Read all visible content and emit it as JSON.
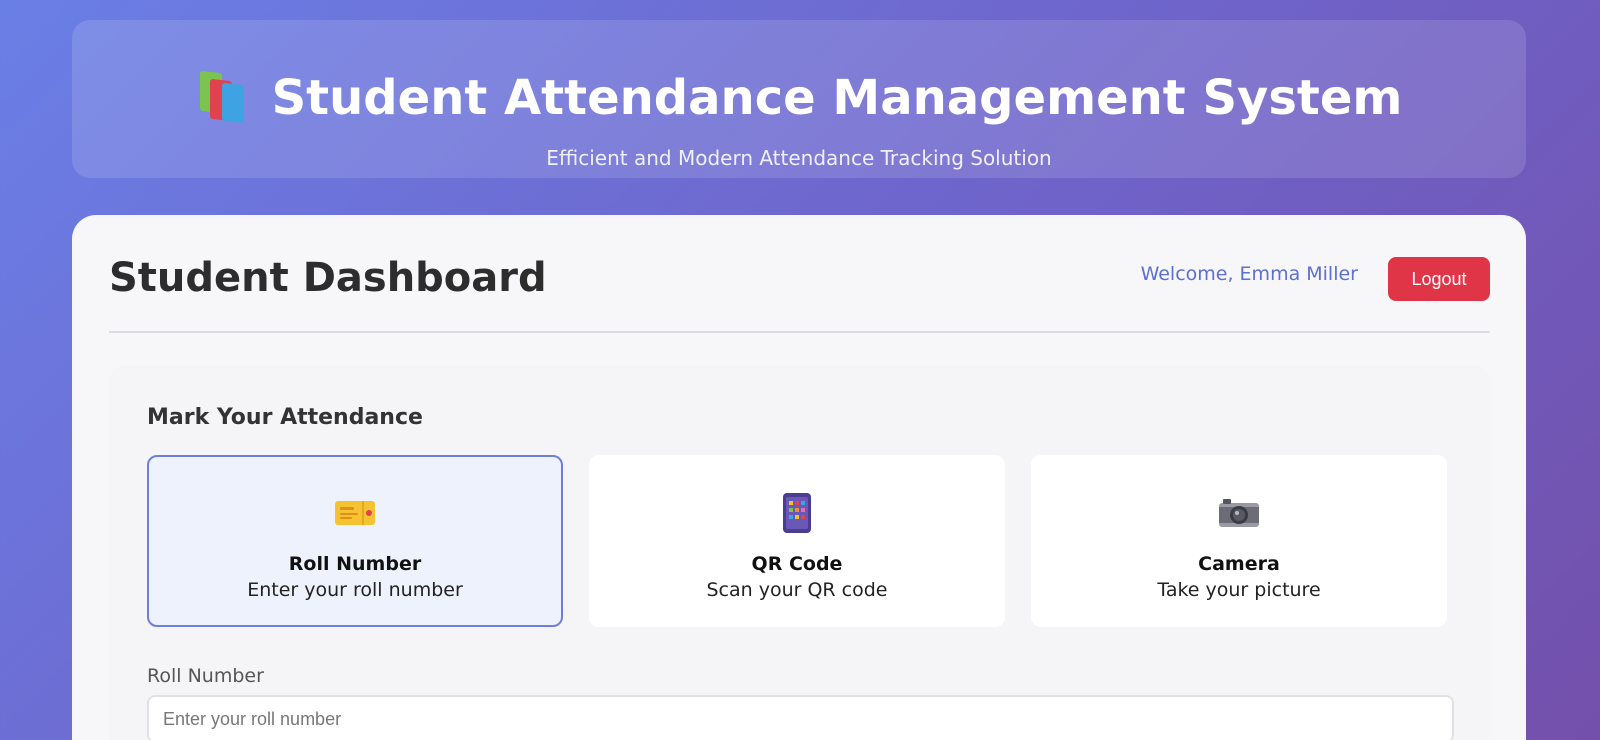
{
  "header": {
    "title": "Student Attendance Management System",
    "subtitle": "Efficient and Modern Attendance Tracking Solution",
    "icon": "books-icon"
  },
  "dashboard": {
    "title": "Student Dashboard",
    "welcome": "Welcome, Emma Miller",
    "logout_label": "Logout"
  },
  "attendance": {
    "title": "Mark Your Attendance",
    "methods": [
      {
        "name": "Roll Number",
        "desc": "Enter your roll number",
        "icon": "ticket-icon",
        "active": true
      },
      {
        "name": "QR Code",
        "desc": "Scan your QR code",
        "icon": "phone-icon",
        "active": false
      },
      {
        "name": "Camera",
        "desc": "Take your picture",
        "icon": "camera-icon",
        "active": false
      }
    ],
    "field_label": "Roll Number",
    "field_placeholder": "Enter your roll number",
    "field_value": ""
  },
  "colors": {
    "accent": "#5c6fd3",
    "logout": "#e03447",
    "active_border": "#6d80d8"
  }
}
